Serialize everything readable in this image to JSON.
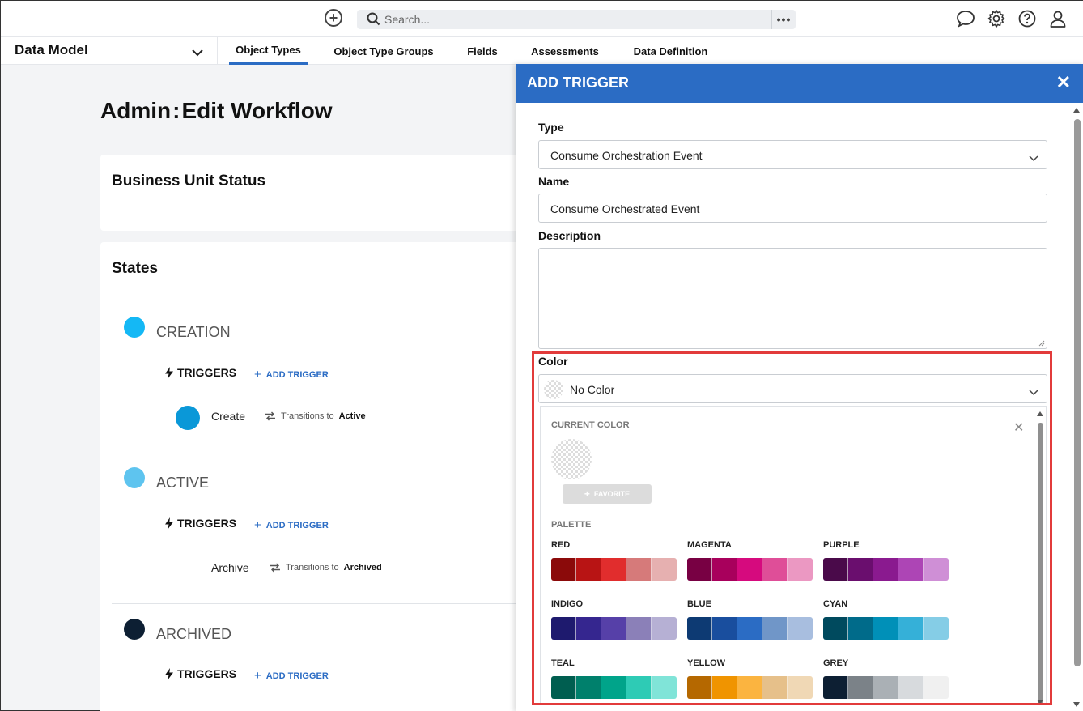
{
  "topbar": {
    "search_placeholder": "Search...",
    "more_glyph": "•••"
  },
  "nav": {
    "select_label": "Data Model",
    "tabs": [
      {
        "label": "Object Types",
        "active": true
      },
      {
        "label": "Object Type Groups",
        "active": false
      },
      {
        "label": "Fields",
        "active": false
      },
      {
        "label": "Assessments",
        "active": false
      },
      {
        "label": "Data Definition",
        "active": false
      }
    ]
  },
  "page": {
    "title_left": "Admin",
    "title_sep": ":",
    "title_right": "Edit Workflow",
    "workflow_name": "Business Unit Status",
    "states_title": "States",
    "triggers_label": "TRIGGERS",
    "add_trigger_label": "ADD TRIGGER",
    "transitions_label": "Transitions to",
    "states": [
      {
        "name": "CREATION",
        "color": "#14b8f5",
        "transition": {
          "name": "Create",
          "to": "Active"
        }
      },
      {
        "name": "ACTIVE",
        "color": "#5ec4ef",
        "transition": {
          "name": "Archive",
          "to": "Archived"
        }
      },
      {
        "name": "ARCHIVED",
        "color": "#0d1f33",
        "transition": null
      }
    ]
  },
  "drawer": {
    "title": "ADD TRIGGER",
    "close_glyph": "✕",
    "type_label": "Type",
    "type_value": "Consume Orchestration Event",
    "name_label": "Name",
    "name_value": "Consume Orchestrated Event",
    "description_label": "Description",
    "description_value": "",
    "color_label": "Color",
    "color_value": "No Color"
  },
  "color_picker": {
    "current_label": "CURRENT COLOR",
    "favorite_label": "FAVORITE",
    "palette_label": "PALETTE",
    "close_glyph": "✕",
    "families": [
      {
        "name": "RED",
        "colors": [
          "#8b0a0a",
          "#b81414",
          "#e12d2d",
          "#d67a7a",
          "#e6b0b0"
        ]
      },
      {
        "name": "MAGENTA",
        "colors": [
          "#780043",
          "#a8005c",
          "#d60a7e",
          "#df4e98",
          "#eb98c2"
        ]
      },
      {
        "name": "PURPLE",
        "colors": [
          "#4a0a4a",
          "#6a0e6e",
          "#8a1a8f",
          "#ad45b5",
          "#cf8fd6"
        ]
      },
      {
        "name": "INDIGO",
        "colors": [
          "#1e1a6e",
          "#35268f",
          "#5640a8",
          "#8b80b8",
          "#b6b0d4"
        ]
      },
      {
        "name": "BLUE",
        "colors": [
          "#0d3a73",
          "#194e9e",
          "#2b6cc4",
          "#7096c8",
          "#a8bedf"
        ]
      },
      {
        "name": "CYAN",
        "colors": [
          "#004a5e",
          "#006b8a",
          "#0090b8",
          "#35b0d8",
          "#85cde6"
        ]
      },
      {
        "name": "TEAL",
        "colors": [
          "#005e50",
          "#00806c",
          "#00a48a",
          "#2ecbb5",
          "#80e4d8"
        ]
      },
      {
        "name": "YELLOW",
        "colors": [
          "#b56800",
          "#f09400",
          "#fbb440",
          "#e6c08a",
          "#f0d8b5"
        ]
      },
      {
        "name": "GREY",
        "colors": [
          "#0d1f33",
          "#7b8288",
          "#aab0b5",
          "#d7dadd",
          "#f0f0f0"
        ]
      }
    ]
  }
}
